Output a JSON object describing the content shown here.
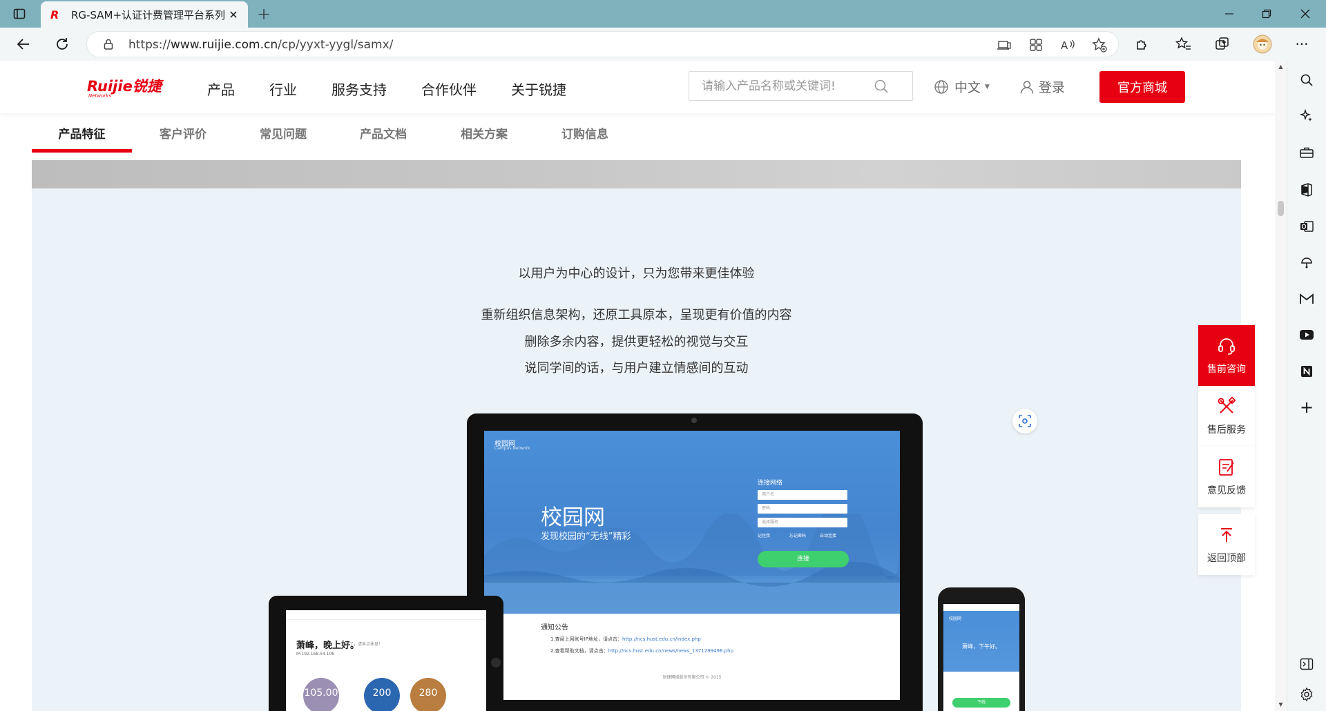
{
  "browser": {
    "tab_title": "RG-SAM+认证计费管理平台系列",
    "url_prefix": "https://",
    "url_domain": "www.ruijie.com.cn",
    "url_path": "/cp/yyxt-yygl/samx/",
    "icons": [
      "tab-actions-icon",
      "ruijie-favicon",
      "close-icon",
      "plus-icon",
      "minimize-icon",
      "restore-icon",
      "close-window-icon",
      "back-icon",
      "refresh-icon",
      "lock-icon",
      "app-available-icon",
      "extensions-grid-icon",
      "read-aloud-icon",
      "add-favorite-icon",
      "puzzle-icon",
      "favorites-icon",
      "collections-icon",
      "profile-avatar",
      "more-icon"
    ],
    "sidebar_icons": [
      "search-icon",
      "copilot-icon",
      "toolbox-icon",
      "office-icon",
      "outlook-icon",
      "games-icon",
      "gmail-icon",
      "youtube-icon",
      "notion-icon",
      "add-icon",
      "sidebar-toggle-icon",
      "settings-icon"
    ]
  },
  "header": {
    "logo_text": "Ruijie锐捷",
    "logo_sub": "Networks",
    "nav": [
      "产品",
      "行业",
      "服务支持",
      "合作伙伴",
      "关于锐捷"
    ],
    "search_placeholder": "请输入产品名称或关键词!",
    "language": "中文",
    "login": "登录",
    "shop_button": "官方商城",
    "brand_color": "#e60012"
  },
  "subnav": {
    "tabs": [
      "产品特征",
      "客户评价",
      "常见问题",
      "产品文档",
      "相关方案",
      "订购信息"
    ],
    "active_index": 0
  },
  "content": {
    "headline": "以用户为中心的设计，只为您带来更佳体验",
    "lines": [
      "重新组织信息架构，还原工具原本，呈现更有价值的内容",
      "删除多余内容，提供更轻松的视觉与交互",
      "说同学间的话，与用户建立情感间的互动"
    ]
  },
  "device_monitor": {
    "brand": "校园网",
    "brand_sub": "Campus Network",
    "title": "校园网",
    "subtitle": "发现校园的“无线”精彩",
    "form_title": "连接网络",
    "fields": [
      "用户名",
      "密码",
      "选择服务"
    ],
    "checks": [
      "记住我",
      "忘记密码",
      "自动连接"
    ],
    "connect": "连接",
    "notice_title": "通知公告",
    "notices": [
      {
        "text": "1.查阅上网账号IP地址，请点击：",
        "link": "http://ncs.hust.edu.cn/index.php"
      },
      {
        "text": "2.查看帮助文档，请点击：",
        "link": "http://ncs.hust.edu.cn/news/news_1371299498.php"
      }
    ],
    "footer": "锐捷网络股份有限公司 © 2015"
  },
  "device_tablet": {
    "greeting": "萧峰，晚上好。",
    "greeting_sub": "您好了，请早点休息！",
    "ip": "IP:192.168.54.106",
    "circles": [
      {
        "value": "105.00",
        "color": "#9b8fb3"
      },
      {
        "value": "200",
        "color": "#2b66b0"
      },
      {
        "value": "280",
        "color": "#b97d3f"
      }
    ]
  },
  "device_phone": {
    "brand": "校园网",
    "greeting": "萧峰，下午好。",
    "button": "下线"
  },
  "float_panel": [
    {
      "label": "售前咨询",
      "icon": "headset-icon"
    },
    {
      "label": "售后服务",
      "icon": "tools-icon"
    },
    {
      "label": "意见反馈",
      "icon": "feedback-icon"
    },
    {
      "label": "返回顶部",
      "icon": "back-to-top-icon"
    }
  ]
}
